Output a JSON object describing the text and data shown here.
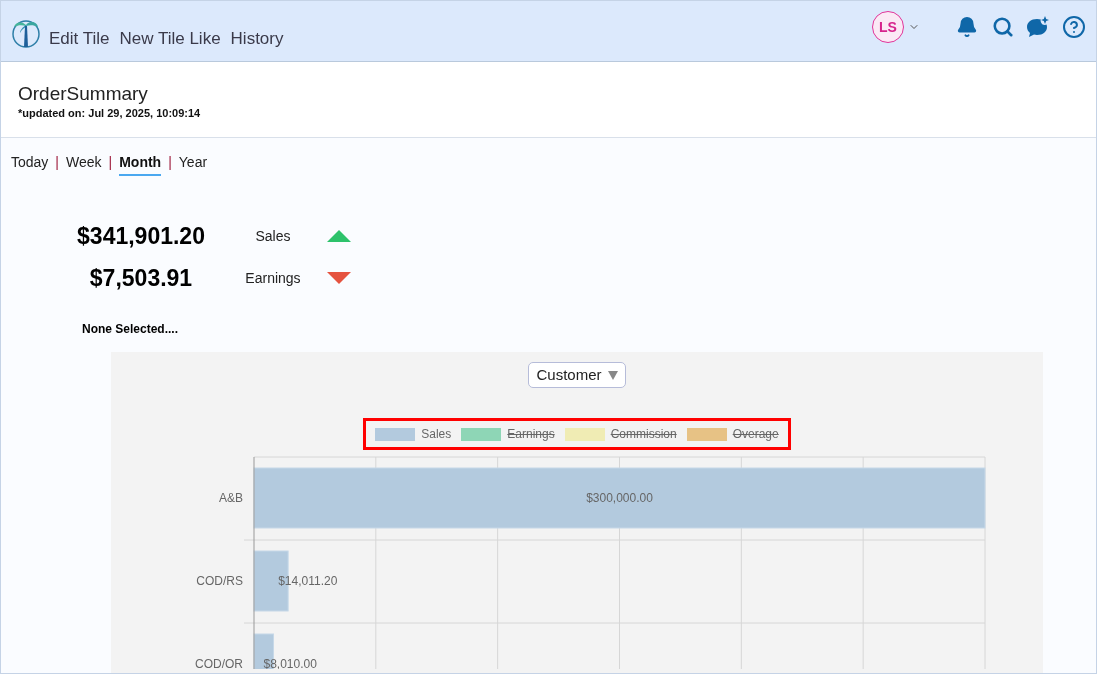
{
  "toolbar": {
    "links": [
      "Edit Tile",
      "New Tile Like",
      "History"
    ],
    "avatar": {
      "initials": "LS"
    }
  },
  "tile": {
    "title": "OrderSummary",
    "updated": "*updated on: Jul 29, 2025, 10:09:14"
  },
  "period_tabs": {
    "separator": "|",
    "items": [
      {
        "label": "Today",
        "selected": false
      },
      {
        "label": "Week",
        "selected": false
      },
      {
        "label": "Month",
        "selected": true
      },
      {
        "label": "Year",
        "selected": false
      }
    ]
  },
  "metrics": [
    {
      "amount": "$341,901.20",
      "label": "Sales",
      "kind": "up"
    },
    {
      "amount": "$7,503.91",
      "label": "Earnings",
      "kind": "down"
    }
  ],
  "selection_note": "None Selected....",
  "chart_panel": {
    "dropdown": {
      "value": "Customer"
    },
    "chart_data": {
      "type": "bar",
      "orientation": "horizontal",
      "categories": [
        "A&B",
        "COD/RS",
        "COD/OR"
      ],
      "series": [
        {
          "name": "Sales",
          "color": "#b3cade",
          "values": [
            300000,
            14011.2,
            8010
          ],
          "value_labels": [
            "$300,000.00",
            "$14,011.20",
            "$8,010.00"
          ]
        }
      ],
      "data_labels": true
    },
    "hidden_series": [
      {
        "label": "Earnings",
        "color": "#8ed6b6",
        "hidden": true
      },
      {
        "label": "Commission",
        "color": "#f0ecb4",
        "hidden": true
      },
      {
        "label": "Overage",
        "color": "#e7c285",
        "hidden": true
      }
    ]
  }
}
